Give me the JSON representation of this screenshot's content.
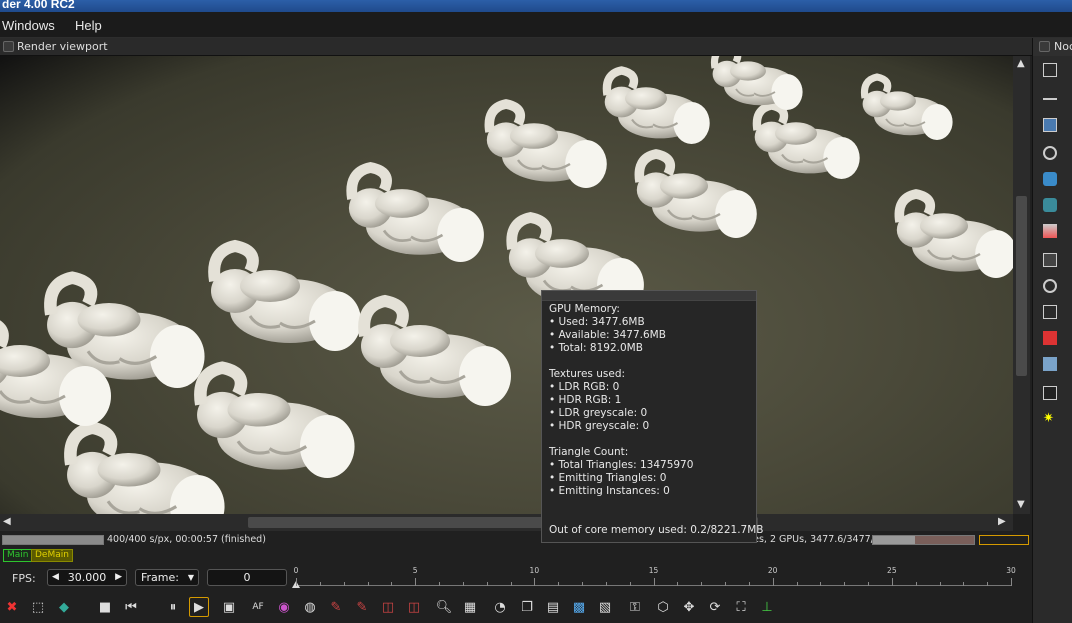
{
  "window": {
    "title": "der 4.00 RC2"
  },
  "menubar": {
    "items": [
      "Windows",
      "Help"
    ]
  },
  "viewport_panel": {
    "title": "Render viewport"
  },
  "node_panel": {
    "title": "Noc"
  },
  "status": {
    "progress": 1.0,
    "text": "400/400 s/px, 00:00:57 (finished)",
    "gpu_text": "0 tris, 13475970 tri, 0 meshes, 2 GPUs, 3477.6/3477/8192 MB",
    "memory_fraction": 0.42
  },
  "tabs": {
    "main": "Main",
    "demain": "DeMain"
  },
  "timeline": {
    "fps_label": "FPS:",
    "fps_value": "30.000",
    "frame_label": "Frame:",
    "frame_value": "0",
    "ruler_ticks": [
      "0",
      "5",
      "10",
      "15",
      "20",
      "25",
      "30"
    ]
  },
  "tooltip": {
    "lines": [
      "GPU Memory:",
      " • Used: 3477.6MB",
      " • Available: 3477.6MB",
      " • Total: 8192.0MB",
      "",
      "Textures used:",
      " • LDR RGB: 0",
      " • HDR RGB: 1",
      " • LDR greyscale: 0",
      " • HDR greyscale: 0",
      "",
      "Triangle Count:",
      " • Total Triangles: 13475970",
      " • Emitting Triangles: 0",
      " • Emitting Instances: 0",
      "",
      "",
      "Out of core memory used: 0.2/8221.7MB"
    ]
  },
  "colors": {
    "main_tab": "#2ec52e",
    "demain_tab": "#8a8a00",
    "accent_frame": "#d59a00"
  }
}
